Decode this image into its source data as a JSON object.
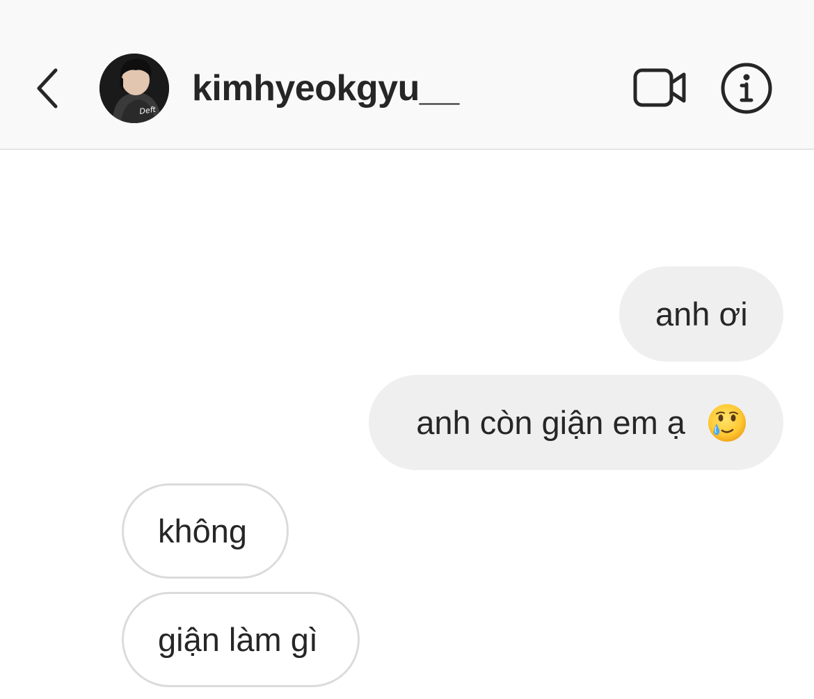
{
  "header": {
    "username": "kimhyeokgyu__",
    "avatar_text": "Deft",
    "back_icon": "chevron-left-icon",
    "video_icon": "video-camera-icon",
    "info_icon": "info-icon"
  },
  "messages": [
    {
      "direction": "sent",
      "text": "anh ơi"
    },
    {
      "direction": "sent",
      "text": "anh còn giận em ạ",
      "emoji": "face-holding-back-tears-icon"
    },
    {
      "direction": "received",
      "text": "không"
    },
    {
      "direction": "received",
      "text": "giận làm gì"
    }
  ],
  "colors": {
    "header_bg": "#f9f9f9",
    "sent_bubble": "#efefef",
    "received_border": "#dbdbdb",
    "text": "#262626"
  }
}
